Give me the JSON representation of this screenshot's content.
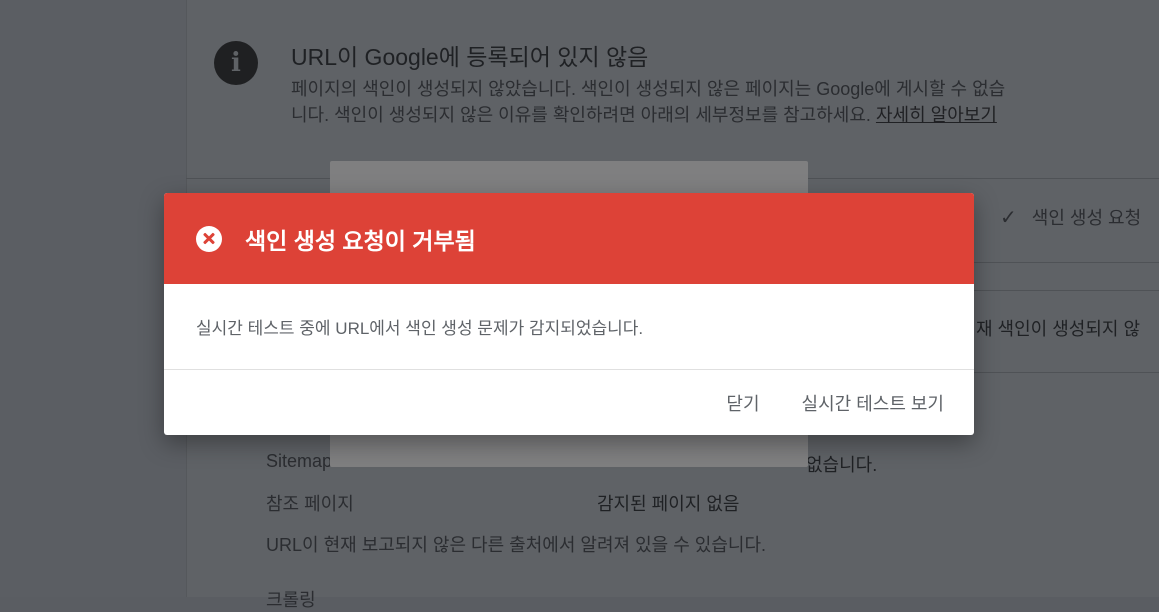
{
  "background": {
    "info_title": "URL이 Google에 등록되어 있지 않음",
    "info_desc": "페이지의 색인이 생성되지 않았습니다. 색인이 생성되지 않은 페이지는 Google에 게시할 수 없습니다. 색인이 생성되지 않은 이유를 확인하려면 아래의 세부정보를 참고하세요.",
    "info_link": "자세히 알아보기",
    "check_row": "색인 생성 요청",
    "status_row": "재 색인이 생성되지 않",
    "rows": [
      {
        "label": "Sitemap",
        "value": "없습니다."
      },
      {
        "label": "참조 페이지",
        "value": "감지된 페이지 없음"
      }
    ],
    "note": "URL이 현재 보고되지 않은 다른 출처에서 알려져 있을 수 있습니다.",
    "bottom_label": "크롤링"
  },
  "dialog": {
    "title": "색인 생성 요청이 거부됨",
    "message": "실시간 테스트 중에 URL에서 색인 생성 문제가 감지되었습니다.",
    "close_label": "닫기",
    "view_live_test_label": "실시간 테스트 보기",
    "colors": {
      "header": "#dd4237",
      "text_secondary": "#5f6368"
    }
  }
}
